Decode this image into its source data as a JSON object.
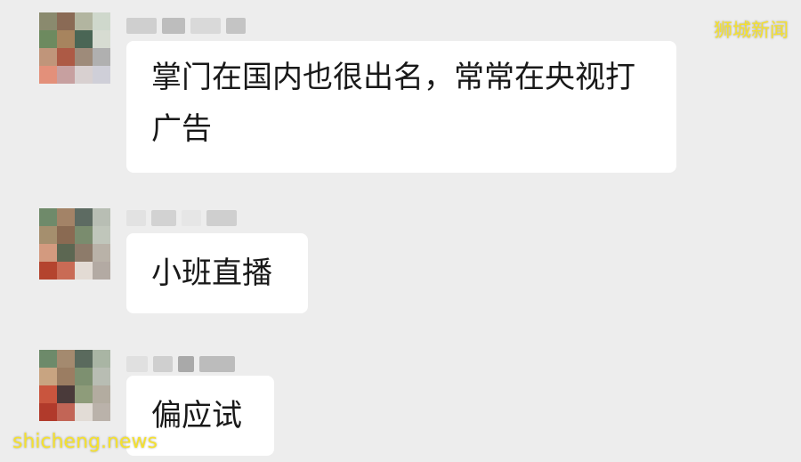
{
  "watermarks": {
    "top_right": "狮城新闻",
    "bottom_left": "shicheng.news"
  },
  "messages": [
    {
      "text": "掌门在国内也很出名，常常在央视打广告",
      "avatar_colors": [
        "#8a8a6e",
        "#8a6a55",
        "#b2b5a0",
        "#cfd8cc",
        "#6d8a5f",
        "#a7845e",
        "#4a6655",
        "#d7dcd2",
        "#c0957a",
        "#ad5a45",
        "#9e8b7a",
        "#b0b0b0",
        "#e3907a",
        "#c7a0a0",
        "#d8d0d0",
        "#cfcfd8"
      ],
      "sender_colors": [
        "#cfcfcf",
        "#bdbdbd",
        "#d9d9d9",
        "#c4c4c4"
      ]
    },
    {
      "text": "小班直播",
      "avatar_colors": [
        "#6f8a6a",
        "#a38367",
        "#5d6b62",
        "#b8beb4",
        "#a58f6e",
        "#8a6a52",
        "#7a8c6e",
        "#c0c6bb",
        "#d39a7f",
        "#5c6752",
        "#8d7b6a",
        "#b9b2a8",
        "#b4442e",
        "#c96b55",
        "#e3dbd4",
        "#b3aaa3"
      ],
      "sender_colors": [
        "#e2e2e2",
        "#d2d2d2",
        "#e6e6e6",
        "#cfcfcf"
      ]
    },
    {
      "text": "偏应试",
      "avatar_colors": [
        "#6d8a6a",
        "#a48a6f",
        "#5a6a5d",
        "#a9b5a4",
        "#c8a481",
        "#9b7d62",
        "#7d9070",
        "#b8bdb3",
        "#c9553e",
        "#4a3a3a",
        "#8e9c7a",
        "#b3aca0",
        "#b13a2b",
        "#c26556",
        "#e2dcd6",
        "#bab2aa"
      ],
      "sender_colors": [
        "#e0e0e0",
        "#cfcfcf",
        "#a9a9a9",
        "#bcbcbc"
      ]
    }
  ]
}
